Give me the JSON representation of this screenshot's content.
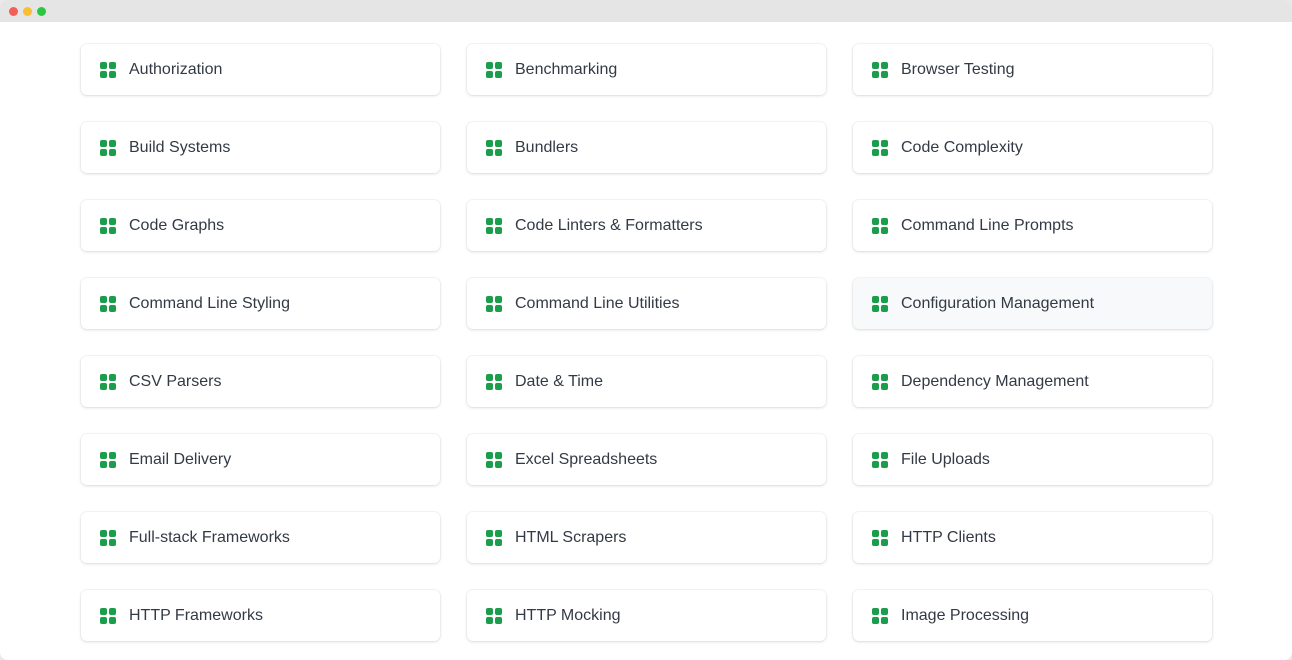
{
  "colors": {
    "accent": "#1a9e4b",
    "text": "#333a45",
    "card_background": "#ffffff",
    "card_hover_background": "#f8f9fa"
  },
  "icon": "grid-icon",
  "categories": [
    {
      "label": "Authorization"
    },
    {
      "label": "Benchmarking"
    },
    {
      "label": "Browser Testing"
    },
    {
      "label": "Build Systems"
    },
    {
      "label": "Bundlers"
    },
    {
      "label": "Code Complexity"
    },
    {
      "label": "Code Graphs"
    },
    {
      "label": "Code Linters & Formatters"
    },
    {
      "label": "Command Line Prompts"
    },
    {
      "label": "Command Line Styling"
    },
    {
      "label": "Command Line Utilities"
    },
    {
      "label": "Configuration Management",
      "hovered": true
    },
    {
      "label": "CSV Parsers"
    },
    {
      "label": "Date & Time"
    },
    {
      "label": "Dependency Management"
    },
    {
      "label": "Email Delivery"
    },
    {
      "label": "Excel Spreadsheets"
    },
    {
      "label": "File Uploads"
    },
    {
      "label": "Full-stack Frameworks"
    },
    {
      "label": "HTML Scrapers"
    },
    {
      "label": "HTTP Clients"
    },
    {
      "label": "HTTP Frameworks"
    },
    {
      "label": "HTTP Mocking"
    },
    {
      "label": "Image Processing"
    }
  ]
}
